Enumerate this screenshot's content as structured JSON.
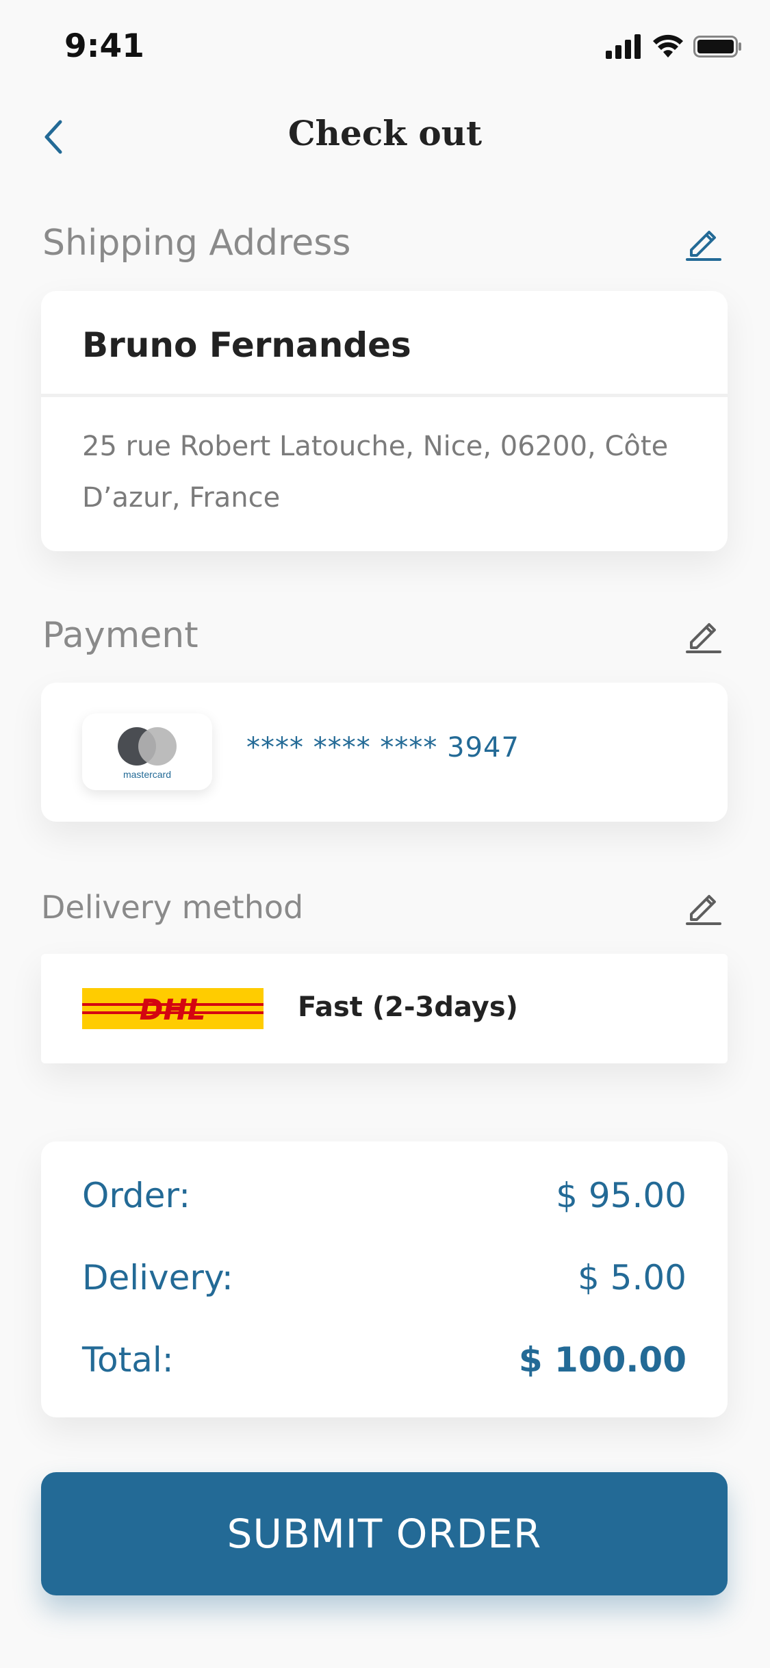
{
  "status_bar": {
    "time": "9:41"
  },
  "header": {
    "title": "Check out"
  },
  "shipping": {
    "label": "Shipping Address",
    "name": "Bruno Fernandes",
    "address_line1": "25 rue Robert Latouche, Nice, 06200, Côte",
    "address_line2": "D’azur, France"
  },
  "payment": {
    "label": "Payment",
    "card_brand": "mastercard",
    "card_number": "**** **** **** 3947"
  },
  "delivery": {
    "label": "Delivery method",
    "carrier": "DHL",
    "speed": "Fast (2-3days)"
  },
  "summary": {
    "order_label": "Order:",
    "order_value": "$ 95.00",
    "delivery_label": "Delivery:",
    "delivery_value": "$ 5.00",
    "total_label": "Total:",
    "total_value": "$ 100.00"
  },
  "submit_label": "SUBMIT ORDER",
  "colors": {
    "primary": "#236A96",
    "background": "#F9F9F9",
    "muted": "#8A8A8A",
    "dhl_yellow": "#FFCC00",
    "dhl_red": "#D40511"
  },
  "icons": [
    "back-chevron-icon",
    "edit-pencil-icon",
    "signal-icon",
    "wifi-icon",
    "battery-icon",
    "mastercard-logo",
    "dhl-logo"
  ]
}
